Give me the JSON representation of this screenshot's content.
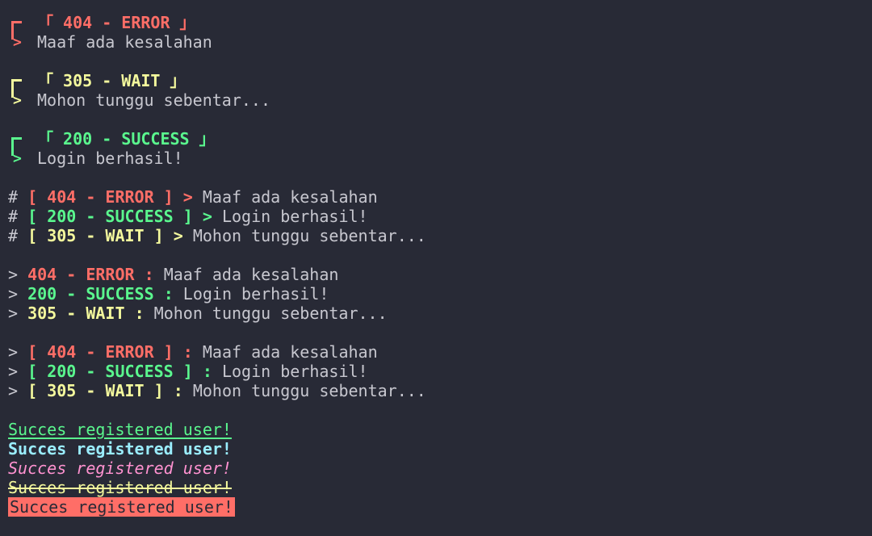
{
  "boxed": [
    {
      "code": "404 - ERROR",
      "open": "「",
      "close": "」",
      "message": "Maaf ada kesalahan",
      "color": "#ff6e67"
    },
    {
      "code": "305 - WAIT",
      "open": "「",
      "close": "」",
      "message": "Mohon tunggu sebentar...",
      "color": "#f4f99d"
    },
    {
      "code": "200 - SUCCESS",
      "open": "「",
      "close": "」",
      "message": "Login berhasil!",
      "color": "#5af78e"
    }
  ],
  "hash_style": [
    {
      "prefix": "#",
      "code": "404 - ERROR",
      "arrow": ">",
      "message": "Maaf ada kesalahan"
    },
    {
      "prefix": "#",
      "code": "200 - SUCCESS",
      "arrow": ">",
      "message": "Login berhasil!"
    },
    {
      "prefix": "#",
      "code": "305 - WAIT",
      "arrow": ">",
      "message": "Mohon tunggu sebentar..."
    }
  ],
  "arrow_plain": [
    {
      "prefix": ">",
      "code": "404 - ERROR",
      "sep": ":",
      "message": "Maaf ada kesalahan"
    },
    {
      "prefix": ">",
      "code": "200 - SUCCESS",
      "sep": ":",
      "message": "Login berhasil!"
    },
    {
      "prefix": ">",
      "code": "305 - WAIT",
      "sep": ":",
      "message": "Mohon tunggu sebentar..."
    }
  ],
  "arrow_bracket": [
    {
      "prefix": ">",
      "code": "404 - ERROR",
      "sep": ":",
      "message": "Maaf ada kesalahan"
    },
    {
      "prefix": ">",
      "code": "200 - SUCCESS",
      "sep": ":",
      "message": "Login berhasil!"
    },
    {
      "prefix": ">",
      "code": "305 - WAIT",
      "sep": ":",
      "message": "Mohon tunggu sebentar..."
    }
  ],
  "styled_text": {
    "underline": "Succes registered user!",
    "bold": "Succes registered user!",
    "italic": "Succes registered user!",
    "strike": "Succes registered user!",
    "background": "Succes registered user!"
  },
  "colors": {
    "background": "#282a36",
    "text": "#d6d6dc",
    "red": "#ff6e67",
    "yellow": "#f4f99d",
    "green": "#5af78e",
    "cyan": "#9aedfe",
    "pink": "#ff92d0"
  }
}
